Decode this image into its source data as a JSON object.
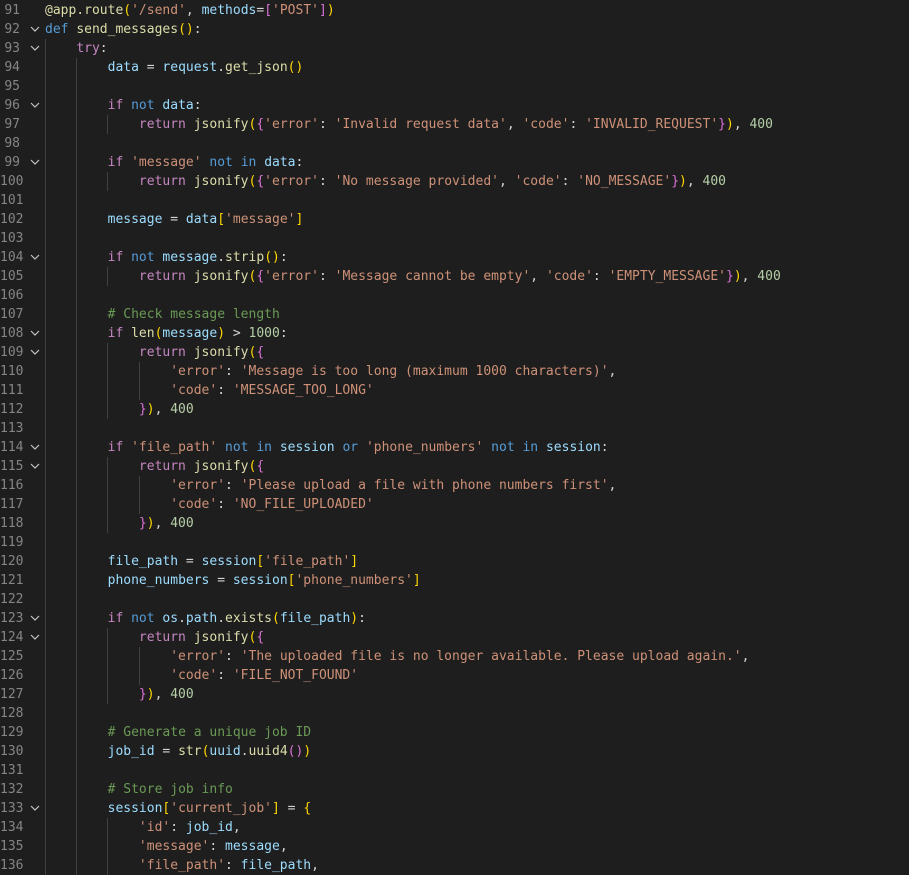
{
  "editor": {
    "language": "python",
    "fold_icon": "chevron-down-icon",
    "lines": [
      {
        "n": "91",
        "fold": false,
        "indent": 0,
        "tokens": [
          [
            "dec",
            "@app.route"
          ],
          [
            "p1",
            "("
          ],
          [
            "str",
            "'/send'"
          ],
          [
            "op",
            ", "
          ],
          [
            "var",
            "methods"
          ],
          [
            "op",
            "="
          ],
          [
            "p2",
            "["
          ],
          [
            "str",
            "'POST'"
          ],
          [
            "p2",
            "]"
          ],
          [
            "p1",
            ")"
          ]
        ]
      },
      {
        "n": "92",
        "fold": true,
        "indent": 0,
        "tokens": [
          [
            "kw",
            "def"
          ],
          [
            "op",
            " "
          ],
          [
            "fn",
            "send_messages"
          ],
          [
            "p1",
            "()"
          ],
          [
            "op",
            ":"
          ]
        ]
      },
      {
        "n": "93",
        "fold": true,
        "indent": 1,
        "tokens": [
          [
            "ctl",
            "try"
          ],
          [
            "op",
            ":"
          ]
        ]
      },
      {
        "n": "94",
        "fold": false,
        "indent": 2,
        "tokens": [
          [
            "var",
            "data"
          ],
          [
            "op",
            " = "
          ],
          [
            "var",
            "request"
          ],
          [
            "op",
            "."
          ],
          [
            "fn",
            "get_json"
          ],
          [
            "p1",
            "()"
          ]
        ]
      },
      {
        "n": "95",
        "fold": false,
        "indent": 2,
        "tokens": []
      },
      {
        "n": "96",
        "fold": true,
        "indent": 2,
        "tokens": [
          [
            "ctl",
            "if"
          ],
          [
            "op",
            " "
          ],
          [
            "kw",
            "not"
          ],
          [
            "op",
            " "
          ],
          [
            "var",
            "data"
          ],
          [
            "op",
            ":"
          ]
        ]
      },
      {
        "n": "97",
        "fold": false,
        "indent": 3,
        "tokens": [
          [
            "ctl",
            "return"
          ],
          [
            "op",
            " "
          ],
          [
            "fn",
            "jsonify"
          ],
          [
            "p1",
            "("
          ],
          [
            "p2",
            "{"
          ],
          [
            "str",
            "'error'"
          ],
          [
            "op",
            ": "
          ],
          [
            "str",
            "'Invalid request data'"
          ],
          [
            "op",
            ", "
          ],
          [
            "str",
            "'code'"
          ],
          [
            "op",
            ": "
          ],
          [
            "str",
            "'INVALID_REQUEST'"
          ],
          [
            "p2",
            "}"
          ],
          [
            "p1",
            ")"
          ],
          [
            "op",
            ", "
          ],
          [
            "num",
            "400"
          ]
        ]
      },
      {
        "n": "98",
        "fold": false,
        "indent": 2,
        "tokens": []
      },
      {
        "n": "99",
        "fold": true,
        "indent": 2,
        "tokens": [
          [
            "ctl",
            "if"
          ],
          [
            "op",
            " "
          ],
          [
            "str",
            "'message'"
          ],
          [
            "op",
            " "
          ],
          [
            "kw",
            "not in"
          ],
          [
            "op",
            " "
          ],
          [
            "var",
            "data"
          ],
          [
            "op",
            ":"
          ]
        ]
      },
      {
        "n": "100",
        "fold": false,
        "indent": 3,
        "tokens": [
          [
            "ctl",
            "return"
          ],
          [
            "op",
            " "
          ],
          [
            "fn",
            "jsonify"
          ],
          [
            "p1",
            "("
          ],
          [
            "p2",
            "{"
          ],
          [
            "str",
            "'error'"
          ],
          [
            "op",
            ": "
          ],
          [
            "str",
            "'No message provided'"
          ],
          [
            "op",
            ", "
          ],
          [
            "str",
            "'code'"
          ],
          [
            "op",
            ": "
          ],
          [
            "str",
            "'NO_MESSAGE'"
          ],
          [
            "p2",
            "}"
          ],
          [
            "p1",
            ")"
          ],
          [
            "op",
            ", "
          ],
          [
            "num",
            "400"
          ]
        ]
      },
      {
        "n": "101",
        "fold": false,
        "indent": 2,
        "tokens": []
      },
      {
        "n": "102",
        "fold": false,
        "indent": 2,
        "tokens": [
          [
            "var",
            "message"
          ],
          [
            "op",
            " = "
          ],
          [
            "var",
            "data"
          ],
          [
            "p1",
            "["
          ],
          [
            "str",
            "'message'"
          ],
          [
            "p1",
            "]"
          ]
        ]
      },
      {
        "n": "103",
        "fold": false,
        "indent": 2,
        "tokens": []
      },
      {
        "n": "104",
        "fold": true,
        "indent": 2,
        "tokens": [
          [
            "ctl",
            "if"
          ],
          [
            "op",
            " "
          ],
          [
            "kw",
            "not"
          ],
          [
            "op",
            " "
          ],
          [
            "var",
            "message"
          ],
          [
            "op",
            "."
          ],
          [
            "fn",
            "strip"
          ],
          [
            "p1",
            "()"
          ],
          [
            "op",
            ":"
          ]
        ]
      },
      {
        "n": "105",
        "fold": false,
        "indent": 3,
        "tokens": [
          [
            "ctl",
            "return"
          ],
          [
            "op",
            " "
          ],
          [
            "fn",
            "jsonify"
          ],
          [
            "p1",
            "("
          ],
          [
            "p2",
            "{"
          ],
          [
            "str",
            "'error'"
          ],
          [
            "op",
            ": "
          ],
          [
            "str",
            "'Message cannot be empty'"
          ],
          [
            "op",
            ", "
          ],
          [
            "str",
            "'code'"
          ],
          [
            "op",
            ": "
          ],
          [
            "str",
            "'EMPTY_MESSAGE'"
          ],
          [
            "p2",
            "}"
          ],
          [
            "p1",
            ")"
          ],
          [
            "op",
            ", "
          ],
          [
            "num",
            "400"
          ]
        ]
      },
      {
        "n": "106",
        "fold": false,
        "indent": 2,
        "tokens": []
      },
      {
        "n": "107",
        "fold": false,
        "indent": 2,
        "tokens": [
          [
            "cmt",
            "# Check message length"
          ]
        ]
      },
      {
        "n": "108",
        "fold": true,
        "indent": 2,
        "tokens": [
          [
            "ctl",
            "if"
          ],
          [
            "op",
            " "
          ],
          [
            "fn",
            "len"
          ],
          [
            "p1",
            "("
          ],
          [
            "var",
            "message"
          ],
          [
            "p1",
            ")"
          ],
          [
            "op",
            " > "
          ],
          [
            "num",
            "1000"
          ],
          [
            "op",
            ":"
          ]
        ]
      },
      {
        "n": "109",
        "fold": true,
        "indent": 3,
        "tokens": [
          [
            "ctl",
            "return"
          ],
          [
            "op",
            " "
          ],
          [
            "fn",
            "jsonify"
          ],
          [
            "p1",
            "("
          ],
          [
            "p2",
            "{"
          ]
        ]
      },
      {
        "n": "110",
        "fold": false,
        "indent": 4,
        "tokens": [
          [
            "str",
            "'error'"
          ],
          [
            "op",
            ": "
          ],
          [
            "str",
            "'Message is too long (maximum 1000 characters)'"
          ],
          [
            "op",
            ","
          ]
        ]
      },
      {
        "n": "111",
        "fold": false,
        "indent": 4,
        "tokens": [
          [
            "str",
            "'code'"
          ],
          [
            "op",
            ": "
          ],
          [
            "str",
            "'MESSAGE_TOO_LONG'"
          ]
        ]
      },
      {
        "n": "112",
        "fold": false,
        "indent": 3,
        "tokens": [
          [
            "p2",
            "}"
          ],
          [
            "p1",
            ")"
          ],
          [
            "op",
            ", "
          ],
          [
            "num",
            "400"
          ]
        ]
      },
      {
        "n": "113",
        "fold": false,
        "indent": 2,
        "tokens": []
      },
      {
        "n": "114",
        "fold": true,
        "indent": 2,
        "tokens": [
          [
            "ctl",
            "if"
          ],
          [
            "op",
            " "
          ],
          [
            "str",
            "'file_path'"
          ],
          [
            "op",
            " "
          ],
          [
            "kw",
            "not in"
          ],
          [
            "op",
            " "
          ],
          [
            "var",
            "session"
          ],
          [
            "op",
            " "
          ],
          [
            "kw",
            "or"
          ],
          [
            "op",
            " "
          ],
          [
            "str",
            "'phone_numbers'"
          ],
          [
            "op",
            " "
          ],
          [
            "kw",
            "not in"
          ],
          [
            "op",
            " "
          ],
          [
            "var",
            "session"
          ],
          [
            "op",
            ":"
          ]
        ]
      },
      {
        "n": "115",
        "fold": true,
        "indent": 3,
        "tokens": [
          [
            "ctl",
            "return"
          ],
          [
            "op",
            " "
          ],
          [
            "fn",
            "jsonify"
          ],
          [
            "p1",
            "("
          ],
          [
            "p2",
            "{"
          ]
        ]
      },
      {
        "n": "116",
        "fold": false,
        "indent": 4,
        "tokens": [
          [
            "str",
            "'error'"
          ],
          [
            "op",
            ": "
          ],
          [
            "str",
            "'Please upload a file with phone numbers first'"
          ],
          [
            "op",
            ","
          ]
        ]
      },
      {
        "n": "117",
        "fold": false,
        "indent": 4,
        "tokens": [
          [
            "str",
            "'code'"
          ],
          [
            "op",
            ": "
          ],
          [
            "str",
            "'NO_FILE_UPLOADED'"
          ]
        ]
      },
      {
        "n": "118",
        "fold": false,
        "indent": 3,
        "tokens": [
          [
            "p2",
            "}"
          ],
          [
            "p1",
            ")"
          ],
          [
            "op",
            ", "
          ],
          [
            "num",
            "400"
          ]
        ]
      },
      {
        "n": "119",
        "fold": false,
        "indent": 2,
        "tokens": []
      },
      {
        "n": "120",
        "fold": false,
        "indent": 2,
        "tokens": [
          [
            "var",
            "file_path"
          ],
          [
            "op",
            " = "
          ],
          [
            "var",
            "session"
          ],
          [
            "p1",
            "["
          ],
          [
            "str",
            "'file_path'"
          ],
          [
            "p1",
            "]"
          ]
        ]
      },
      {
        "n": "121",
        "fold": false,
        "indent": 2,
        "tokens": [
          [
            "var",
            "phone_numbers"
          ],
          [
            "op",
            " = "
          ],
          [
            "var",
            "session"
          ],
          [
            "p1",
            "["
          ],
          [
            "str",
            "'phone_numbers'"
          ],
          [
            "p1",
            "]"
          ]
        ]
      },
      {
        "n": "122",
        "fold": false,
        "indent": 2,
        "tokens": []
      },
      {
        "n": "123",
        "fold": true,
        "indent": 2,
        "tokens": [
          [
            "ctl",
            "if"
          ],
          [
            "op",
            " "
          ],
          [
            "kw",
            "not"
          ],
          [
            "op",
            " "
          ],
          [
            "var",
            "os"
          ],
          [
            "op",
            "."
          ],
          [
            "var",
            "path"
          ],
          [
            "op",
            "."
          ],
          [
            "fn",
            "exists"
          ],
          [
            "p1",
            "("
          ],
          [
            "var",
            "file_path"
          ],
          [
            "p1",
            ")"
          ],
          [
            "op",
            ":"
          ]
        ]
      },
      {
        "n": "124",
        "fold": true,
        "indent": 3,
        "tokens": [
          [
            "ctl",
            "return"
          ],
          [
            "op",
            " "
          ],
          [
            "fn",
            "jsonify"
          ],
          [
            "p1",
            "("
          ],
          [
            "p2",
            "{"
          ]
        ]
      },
      {
        "n": "125",
        "fold": false,
        "indent": 4,
        "tokens": [
          [
            "str",
            "'error'"
          ],
          [
            "op",
            ": "
          ],
          [
            "str",
            "'The uploaded file is no longer available. Please upload again.'"
          ],
          [
            "op",
            ","
          ]
        ]
      },
      {
        "n": "126",
        "fold": false,
        "indent": 4,
        "tokens": [
          [
            "str",
            "'code'"
          ],
          [
            "op",
            ": "
          ],
          [
            "str",
            "'FILE_NOT_FOUND'"
          ]
        ]
      },
      {
        "n": "127",
        "fold": false,
        "indent": 3,
        "tokens": [
          [
            "p2",
            "}"
          ],
          [
            "p1",
            ")"
          ],
          [
            "op",
            ", "
          ],
          [
            "num",
            "400"
          ]
        ]
      },
      {
        "n": "128",
        "fold": false,
        "indent": 2,
        "tokens": []
      },
      {
        "n": "129",
        "fold": false,
        "indent": 2,
        "tokens": [
          [
            "cmt",
            "# Generate a unique job ID"
          ]
        ]
      },
      {
        "n": "130",
        "fold": false,
        "indent": 2,
        "tokens": [
          [
            "var",
            "job_id"
          ],
          [
            "op",
            " = "
          ],
          [
            "fn",
            "str"
          ],
          [
            "p1",
            "("
          ],
          [
            "var",
            "uuid"
          ],
          [
            "op",
            "."
          ],
          [
            "fn",
            "uuid4"
          ],
          [
            "p2",
            "()"
          ],
          [
            "p1",
            ")"
          ]
        ]
      },
      {
        "n": "131",
        "fold": false,
        "indent": 2,
        "tokens": []
      },
      {
        "n": "132",
        "fold": false,
        "indent": 2,
        "tokens": [
          [
            "cmt",
            "# Store job info"
          ]
        ]
      },
      {
        "n": "133",
        "fold": true,
        "indent": 2,
        "tokens": [
          [
            "var",
            "session"
          ],
          [
            "p1",
            "["
          ],
          [
            "str",
            "'current_job'"
          ],
          [
            "p1",
            "]"
          ],
          [
            "op",
            " = "
          ],
          [
            "p1",
            "{"
          ]
        ]
      },
      {
        "n": "134",
        "fold": false,
        "indent": 3,
        "tokens": [
          [
            "str",
            "'id'"
          ],
          [
            "op",
            ": "
          ],
          [
            "var",
            "job_id"
          ],
          [
            "op",
            ","
          ]
        ]
      },
      {
        "n": "135",
        "fold": false,
        "indent": 3,
        "tokens": [
          [
            "str",
            "'message'"
          ],
          [
            "op",
            ": "
          ],
          [
            "var",
            "message"
          ],
          [
            "op",
            ","
          ]
        ]
      },
      {
        "n": "136",
        "fold": false,
        "indent": 3,
        "tokens": [
          [
            "str",
            "'file_path'"
          ],
          [
            "op",
            ": "
          ],
          [
            "var",
            "file_path"
          ],
          [
            "op",
            ","
          ]
        ]
      }
    ]
  }
}
